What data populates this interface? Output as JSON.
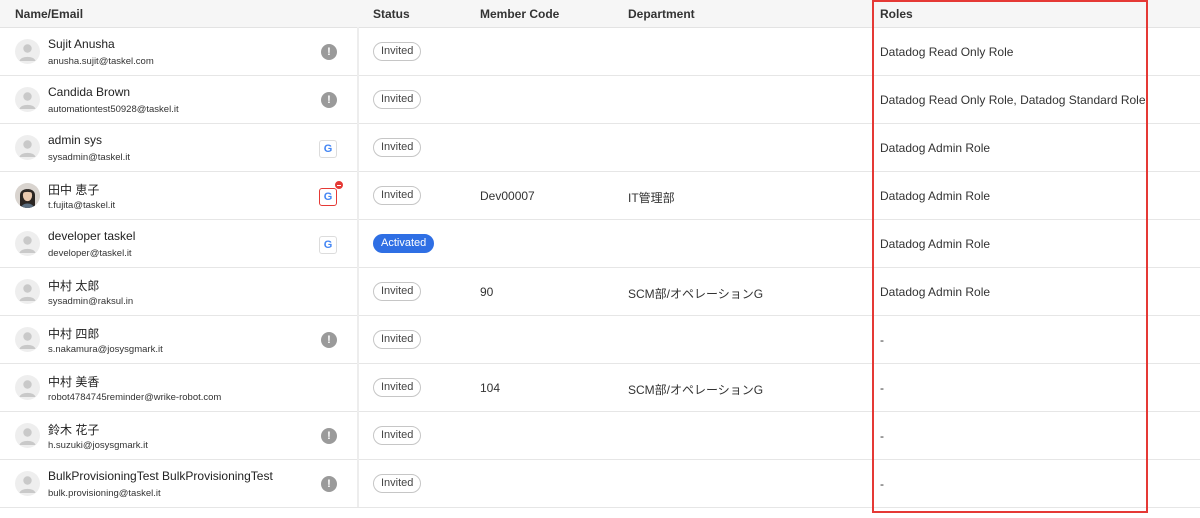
{
  "columns": {
    "name_email": "Name/Email",
    "status": "Status",
    "member_code": "Member Code",
    "department": "Department",
    "roles": "Roles"
  },
  "rows": [
    {
      "name": "Sujit Anusha",
      "email": "anusha.sujit@taskel.com",
      "icon": "warning-icon",
      "status": "Invited",
      "member_code": "",
      "department": "",
      "roles": "Datadog Read Only Role"
    },
    {
      "name": "Candida Brown",
      "email": "automationtest50928@taskel.it",
      "icon": "warning-icon",
      "status": "Invited",
      "member_code": "",
      "department": "",
      "roles": "Datadog Read Only Role, Datadog Standard Role"
    },
    {
      "name": "admin sys",
      "email": "sysadmin@taskel.it",
      "icon": "google-icon",
      "status": "Invited",
      "member_code": "",
      "department": "",
      "roles": "Datadog Admin Role"
    },
    {
      "name": "田中 恵子",
      "email": "t.fujita@taskel.it",
      "icon": "google-alert-icon",
      "status": "Invited",
      "member_code": "Dev00007",
      "department": "IT管理部",
      "roles": "Datadog Admin Role"
    },
    {
      "name": "developer taskel",
      "email": "developer@taskel.it",
      "icon": "google-icon",
      "status": "Activated",
      "member_code": "",
      "department": "",
      "roles": "Datadog Admin Role"
    },
    {
      "name": "中村 太郎",
      "email": "sysadmin@raksul.in",
      "icon": "",
      "status": "Invited",
      "member_code": "90",
      "department": "SCM部/オペレーションG",
      "roles": "Datadog Admin Role"
    },
    {
      "name": "中村 四郎",
      "email": "s.nakamura@josysgmark.it",
      "icon": "warning-icon",
      "status": "Invited",
      "member_code": "",
      "department": "",
      "roles": "-"
    },
    {
      "name": "中村 美香",
      "email": "robot4784745reminder@wrike-robot.com",
      "icon": "",
      "status": "Invited",
      "member_code": "104",
      "department": "SCM部/オペレーションG",
      "roles": "-"
    },
    {
      "name": "鈴木 花子",
      "email": "h.suzuki@josysgmark.it",
      "icon": "warning-icon",
      "status": "Invited",
      "member_code": "",
      "department": "",
      "roles": "-"
    },
    {
      "name": "BulkProvisioningTest BulkProvisioningTest",
      "email": "bulk.provisioning@taskel.it",
      "icon": "warning-icon",
      "status": "Invited",
      "member_code": "",
      "department": "",
      "roles": "-"
    }
  ],
  "icons": {
    "warning_glyph": "!",
    "google_glyph": "G"
  },
  "colors": {
    "activated_badge": "#2f6fe4",
    "highlight_border": "#e53935",
    "warning_icon": "#9a9a9a",
    "google_blue": "#4285f4"
  }
}
